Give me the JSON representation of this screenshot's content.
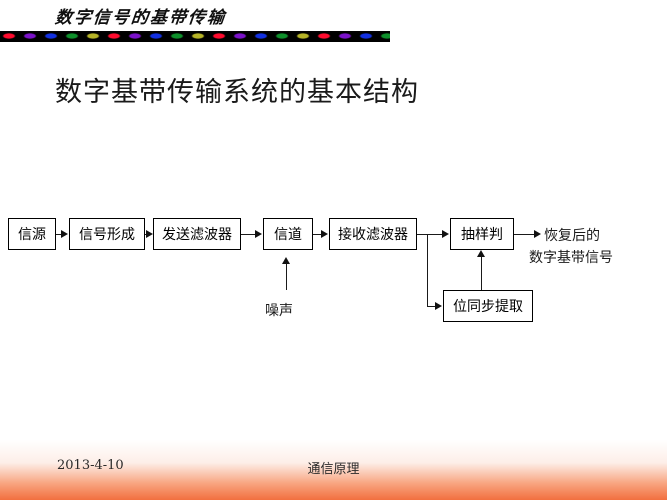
{
  "header": {
    "banner_title": "数字信号的基带传输",
    "rainbow_colors": [
      "#ff0b2e",
      "#7b12c9",
      "#1230e0",
      "#0e8f2b",
      "#b5b327"
    ],
    "rainbow_background": "#000000"
  },
  "slide": {
    "title": "数字基带传输系统的基本结构"
  },
  "diagram": {
    "blocks": [
      {
        "id": "source",
        "label": "信源"
      },
      {
        "id": "signal-forming",
        "label": "信号形成"
      },
      {
        "id": "transmit-filter",
        "label": "发送滤波器"
      },
      {
        "id": "channel",
        "label": "信道"
      },
      {
        "id": "receive-filter",
        "label": "接收滤波器"
      },
      {
        "id": "sampling-decision",
        "label": "抽样判"
      },
      {
        "id": "bit-sync-extract",
        "label": "位同步提取"
      }
    ],
    "labels": [
      {
        "id": "noise",
        "label": "噪声"
      },
      {
        "id": "output-line-1",
        "label": "恢复后的"
      },
      {
        "id": "output-line-2",
        "label": "数字基带信号"
      }
    ]
  },
  "footer": {
    "date": "2013-4-10",
    "center_text": "通信原理",
    "accent_color": "#f26f3f"
  }
}
